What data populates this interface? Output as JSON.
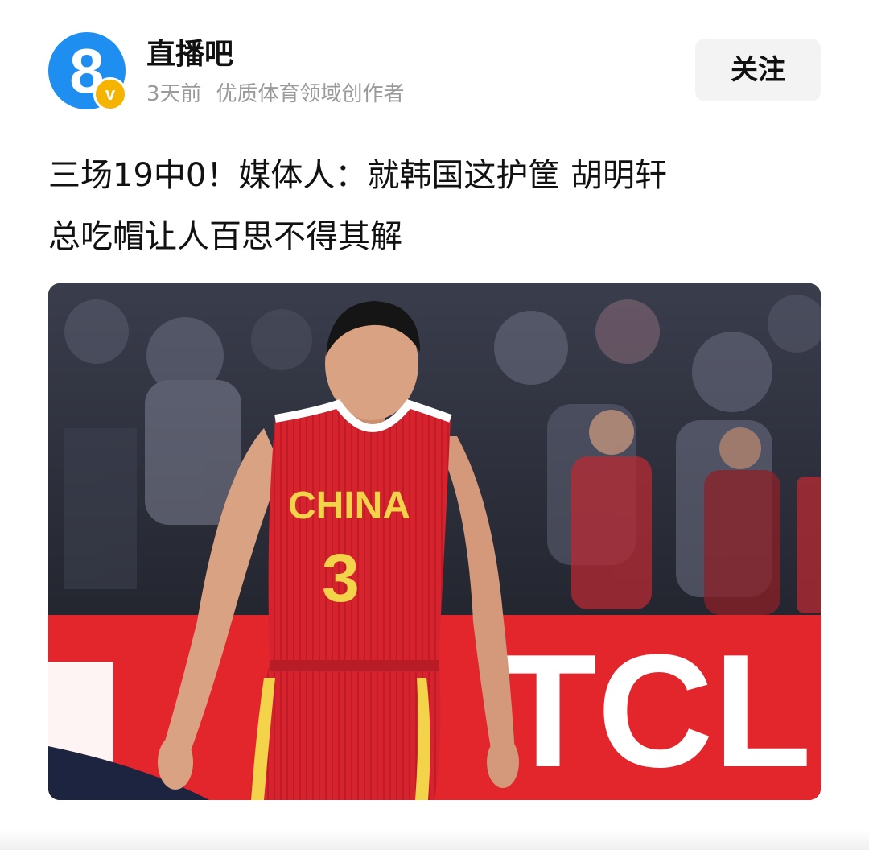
{
  "author": {
    "name": "直播吧",
    "time": "3天前",
    "tag": "优质体育领域创作者",
    "avatar_glyph": "8",
    "verified_glyph": "v",
    "avatar_color": "#1e8ff0",
    "verified_color": "#f5b400"
  },
  "follow_label": "关注",
  "article": {
    "title_line1": "三场19中0！媒体人：就韩国这护筐 胡明轩",
    "title_line2": "总吃帽让人百思不得其解"
  },
  "photo": {
    "jersey_text": "CHINA",
    "jersey_number": "3",
    "ad_board_text": "TCL",
    "jersey_color": "#d6232e",
    "accent_color": "#f2d34a"
  }
}
